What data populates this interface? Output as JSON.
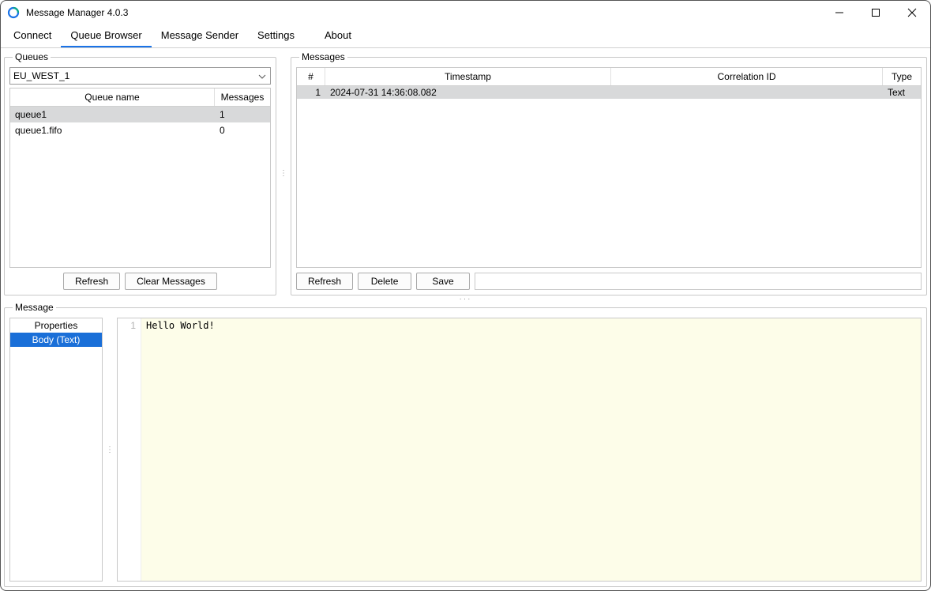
{
  "window": {
    "title": "Message Manager 4.0.3"
  },
  "menubar": {
    "tabs": [
      {
        "label": "Connect"
      },
      {
        "label": "Queue Browser"
      },
      {
        "label": "Message Sender"
      },
      {
        "label": "Settings"
      },
      {
        "label": "About"
      }
    ],
    "active_index": 1
  },
  "queues_panel": {
    "legend": "Queues",
    "region_select": {
      "value": "EU_WEST_1"
    },
    "columns": {
      "name": "Queue name",
      "messages": "Messages"
    },
    "rows": [
      {
        "name": "queue1",
        "messages": "1",
        "selected": true
      },
      {
        "name": "queue1.fifo",
        "messages": "0",
        "selected": false
      }
    ],
    "buttons": {
      "refresh": "Refresh",
      "clear": "Clear Messages"
    }
  },
  "messages_panel": {
    "legend": "Messages",
    "columns": {
      "num": "#",
      "timestamp": "Timestamp",
      "corr": "Correlation ID",
      "type": "Type"
    },
    "rows": [
      {
        "num": "1",
        "timestamp": "2024-07-31 14:36:08.082",
        "corr": "",
        "type": "Text",
        "selected": true
      }
    ],
    "buttons": {
      "refresh": "Refresh",
      "delete": "Delete",
      "save": "Save"
    }
  },
  "message_detail": {
    "legend": "Message",
    "sidebar": {
      "items": [
        {
          "label": "Properties",
          "selected": false
        },
        {
          "label": "Body (Text)",
          "selected": true
        }
      ]
    },
    "editor": {
      "line_no": "1",
      "content": "Hello World!"
    }
  }
}
